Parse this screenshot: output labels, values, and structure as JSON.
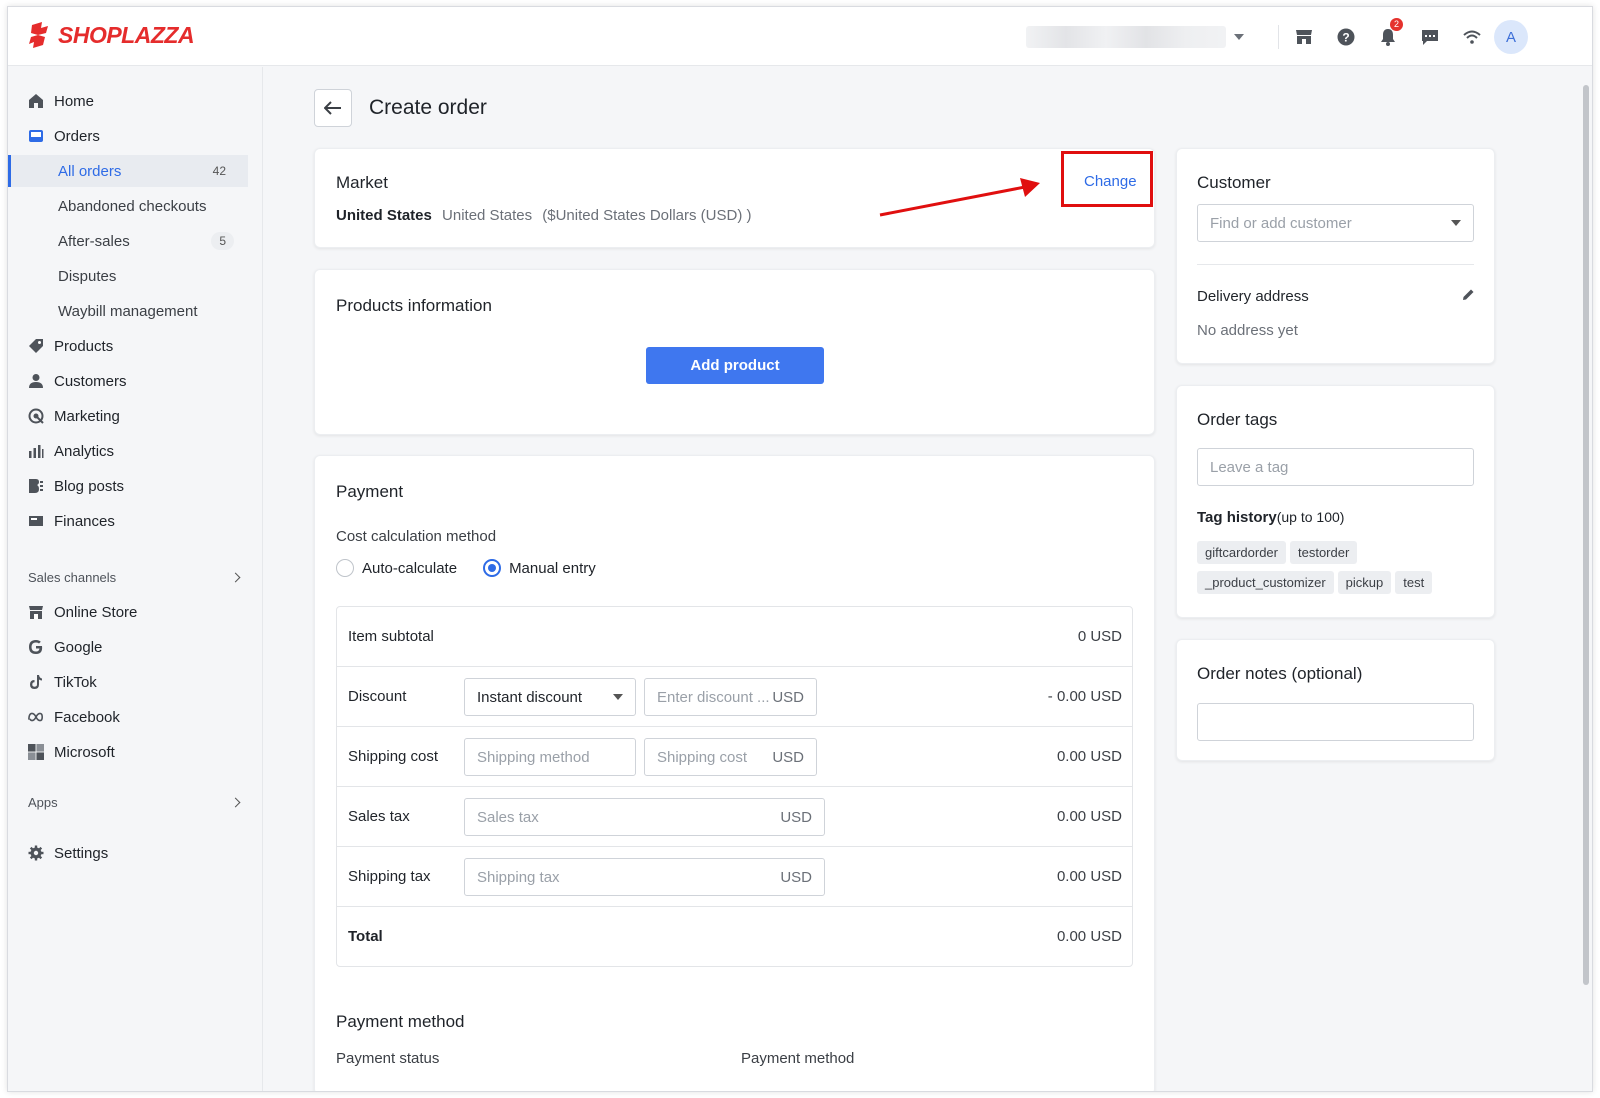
{
  "brand": {
    "name": "SHOPLAZZA",
    "color": "#e52c2c",
    "accent": "#2e6be6"
  },
  "topbar": {
    "icons": [
      "store-icon",
      "help-icon",
      "bell-icon",
      "chat-icon",
      "wifi-icon"
    ],
    "notification_count": "2",
    "avatar_initial": "A"
  },
  "sidebar": {
    "items": [
      {
        "label": "Home",
        "icon": "home-icon"
      },
      {
        "label": "Orders",
        "icon": "orders-icon"
      },
      {
        "label": "All orders",
        "count": "42"
      },
      {
        "label": "Abandoned checkouts"
      },
      {
        "label": "After-sales",
        "count": "5"
      },
      {
        "label": "Disputes"
      },
      {
        "label": "Waybill management"
      },
      {
        "label": "Products",
        "icon": "tag-icon"
      },
      {
        "label": "Customers",
        "icon": "person-icon"
      },
      {
        "label": "Marketing",
        "icon": "marketing-icon"
      },
      {
        "label": "Analytics",
        "icon": "analytics-icon"
      },
      {
        "label": "Blog posts",
        "icon": "blog-icon"
      },
      {
        "label": "Finances",
        "icon": "finances-icon"
      }
    ],
    "sales_channels_label": "Sales channels",
    "channels": [
      {
        "label": "Online Store",
        "icon": "store-icon"
      },
      {
        "label": "Google",
        "icon": "google-icon"
      },
      {
        "label": "TikTok",
        "icon": "tiktok-icon"
      },
      {
        "label": "Facebook",
        "icon": "meta-icon"
      },
      {
        "label": "Microsoft",
        "icon": "microsoft-icon"
      }
    ],
    "apps_label": "Apps",
    "settings_label": "Settings"
  },
  "page": {
    "title": "Create order"
  },
  "market": {
    "title": "Market",
    "country": "United States",
    "region": "United States",
    "currency": "($United States Dollars (USD) )",
    "change_label": "Change"
  },
  "products": {
    "title": "Products information",
    "add_label": "Add product"
  },
  "payment": {
    "title": "Payment",
    "method_label": "Cost calculation method",
    "option_auto": "Auto-calculate",
    "option_manual": "Manual entry",
    "selected": "Manual entry",
    "rows": {
      "subtotal": {
        "label": "Item subtotal",
        "value": "0 USD"
      },
      "discount": {
        "label": "Discount",
        "type": "Instant discount",
        "placeholder": "Enter discount ...",
        "unit": "USD",
        "value": "- 0.00 USD"
      },
      "shipping": {
        "label": "Shipping cost",
        "method_placeholder": "Shipping method",
        "cost_placeholder": "Shipping cost",
        "unit": "USD",
        "value": "0.00 USD"
      },
      "sales_tax": {
        "label": "Sales tax",
        "placeholder": "Sales tax",
        "unit": "USD",
        "value": "0.00 USD"
      },
      "shipping_tax": {
        "label": "Shipping tax",
        "placeholder": "Shipping tax",
        "unit": "USD",
        "value": "0.00 USD"
      },
      "total": {
        "label": "Total",
        "value": "0.00 USD"
      }
    },
    "payment_method_title": "Payment method",
    "payment_status_label": "Payment status",
    "payment_method_label": "Payment method"
  },
  "customer": {
    "title": "Customer",
    "placeholder": "Find or add customer",
    "delivery_title": "Delivery address",
    "delivery_value": "No address yet"
  },
  "order_tags": {
    "title": "Order tags",
    "placeholder": "Leave a tag",
    "history_label": "Tag history",
    "history_note": "(up to 100)",
    "tags": [
      "giftcardorder",
      "testorder",
      "_product_customizer",
      "pickup",
      "test"
    ]
  },
  "order_notes": {
    "title": "Order notes (optional)",
    "value": ""
  }
}
